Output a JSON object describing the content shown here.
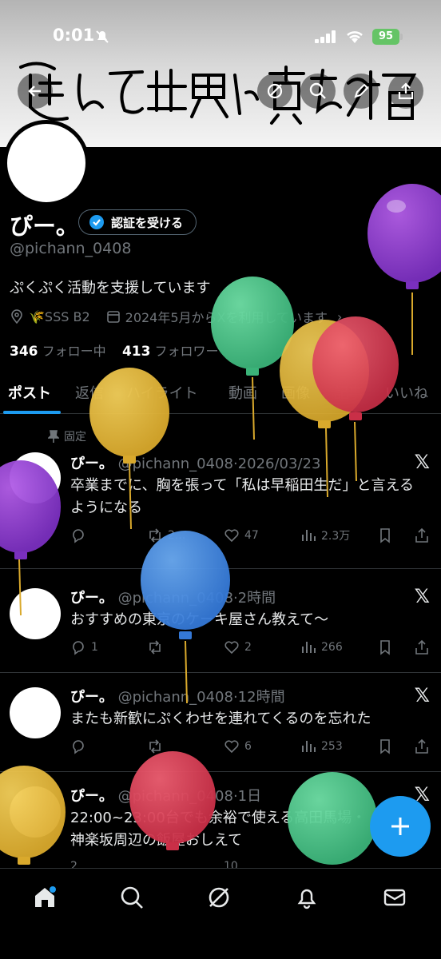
{
  "status_bar": {
    "time": "0:01",
    "battery": "95"
  },
  "banner": {
    "handwriting": "進んで世界に貢献する抱負"
  },
  "profile": {
    "name": "ぴー。",
    "verify_button": "認証を受ける",
    "handle": "@pichann_0408",
    "bio": "ぷくぷく活動を支援しています",
    "location": "🌾SSS B2",
    "joined": "2024年5月からXを利用しています",
    "following_count": "346",
    "following_label": "フォロー中",
    "followers_count": "413",
    "followers_label": "フォロワー"
  },
  "tabs": [
    "ポスト",
    "返信",
    "ハイライト",
    "動画",
    "画像",
    "記事",
    "いいね"
  ],
  "pinned_label": "固定",
  "posts": [
    {
      "name": "ぴー。",
      "meta": "@pichann_0408·2026/03/23",
      "text": "卒業までに、胸を張って「私は早稲田生だ」と言えるようになる",
      "replies": "",
      "reposts": "2...",
      "likes": "47",
      "views": "2.3万"
    },
    {
      "name": "ぴー。",
      "meta": "@pichann_0408·2時間",
      "text": "おすすめの東京のケーキ屋さん教えて〜",
      "replies": "1",
      "reposts": "",
      "likes": "2",
      "views": "266"
    },
    {
      "name": "ぴー。",
      "meta": "@pichann_0408·12時間",
      "text": "またも新歓にぷくわせを連れてくるのを忘れた",
      "replies": "",
      "reposts": "",
      "likes": "6",
      "views": "253"
    },
    {
      "name": "ぴー。",
      "meta": "@pichann_0408·1日",
      "text": "22:00~23:00台でも余裕で使える高田馬場・神楽坂周辺の飯屋おしえて",
      "replies": "2",
      "reposts": "",
      "likes": "10",
      "views": ""
    }
  ],
  "colors": {
    "accent": "#1d9bf0",
    "background": "#000000",
    "muted": "#71767b"
  },
  "icons": [
    "back-icon",
    "circle-slash-icon",
    "search-icon",
    "edit-icon",
    "share-icon",
    "home-icon",
    "explore-icon",
    "grok-icon",
    "bell-icon",
    "mail-icon",
    "plus-icon"
  ]
}
